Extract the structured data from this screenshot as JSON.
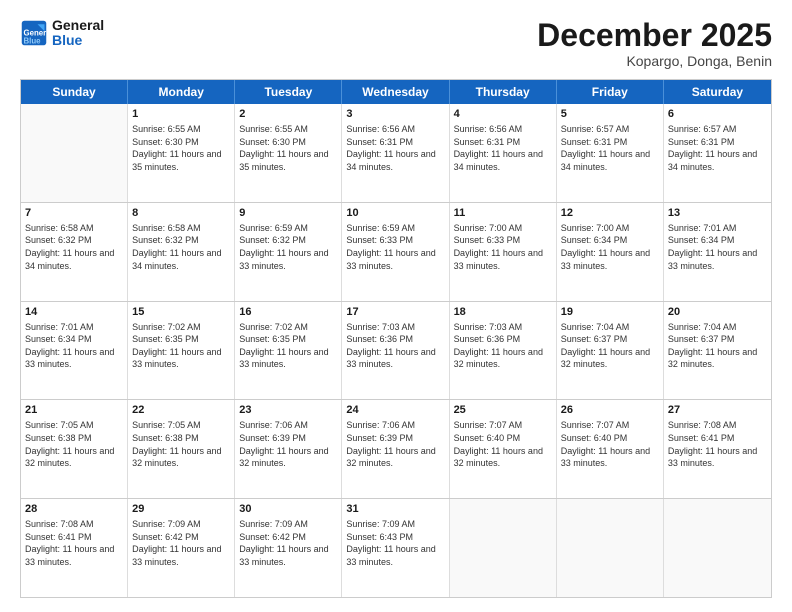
{
  "header": {
    "logo_line1": "General",
    "logo_line2": "Blue",
    "month": "December 2025",
    "location": "Kopargo, Donga, Benin"
  },
  "days_of_week": [
    "Sunday",
    "Monday",
    "Tuesday",
    "Wednesday",
    "Thursday",
    "Friday",
    "Saturday"
  ],
  "weeks": [
    [
      {
        "day": "",
        "sunrise": "",
        "sunset": "",
        "daylight": ""
      },
      {
        "day": "1",
        "sunrise": "Sunrise: 6:55 AM",
        "sunset": "Sunset: 6:30 PM",
        "daylight": "Daylight: 11 hours and 35 minutes."
      },
      {
        "day": "2",
        "sunrise": "Sunrise: 6:55 AM",
        "sunset": "Sunset: 6:30 PM",
        "daylight": "Daylight: 11 hours and 35 minutes."
      },
      {
        "day": "3",
        "sunrise": "Sunrise: 6:56 AM",
        "sunset": "Sunset: 6:31 PM",
        "daylight": "Daylight: 11 hours and 34 minutes."
      },
      {
        "day": "4",
        "sunrise": "Sunrise: 6:56 AM",
        "sunset": "Sunset: 6:31 PM",
        "daylight": "Daylight: 11 hours and 34 minutes."
      },
      {
        "day": "5",
        "sunrise": "Sunrise: 6:57 AM",
        "sunset": "Sunset: 6:31 PM",
        "daylight": "Daylight: 11 hours and 34 minutes."
      },
      {
        "day": "6",
        "sunrise": "Sunrise: 6:57 AM",
        "sunset": "Sunset: 6:31 PM",
        "daylight": "Daylight: 11 hours and 34 minutes."
      }
    ],
    [
      {
        "day": "7",
        "sunrise": "Sunrise: 6:58 AM",
        "sunset": "Sunset: 6:32 PM",
        "daylight": "Daylight: 11 hours and 34 minutes."
      },
      {
        "day": "8",
        "sunrise": "Sunrise: 6:58 AM",
        "sunset": "Sunset: 6:32 PM",
        "daylight": "Daylight: 11 hours and 34 minutes."
      },
      {
        "day": "9",
        "sunrise": "Sunrise: 6:59 AM",
        "sunset": "Sunset: 6:32 PM",
        "daylight": "Daylight: 11 hours and 33 minutes."
      },
      {
        "day": "10",
        "sunrise": "Sunrise: 6:59 AM",
        "sunset": "Sunset: 6:33 PM",
        "daylight": "Daylight: 11 hours and 33 minutes."
      },
      {
        "day": "11",
        "sunrise": "Sunrise: 7:00 AM",
        "sunset": "Sunset: 6:33 PM",
        "daylight": "Daylight: 11 hours and 33 minutes."
      },
      {
        "day": "12",
        "sunrise": "Sunrise: 7:00 AM",
        "sunset": "Sunset: 6:34 PM",
        "daylight": "Daylight: 11 hours and 33 minutes."
      },
      {
        "day": "13",
        "sunrise": "Sunrise: 7:01 AM",
        "sunset": "Sunset: 6:34 PM",
        "daylight": "Daylight: 11 hours and 33 minutes."
      }
    ],
    [
      {
        "day": "14",
        "sunrise": "Sunrise: 7:01 AM",
        "sunset": "Sunset: 6:34 PM",
        "daylight": "Daylight: 11 hours and 33 minutes."
      },
      {
        "day": "15",
        "sunrise": "Sunrise: 7:02 AM",
        "sunset": "Sunset: 6:35 PM",
        "daylight": "Daylight: 11 hours and 33 minutes."
      },
      {
        "day": "16",
        "sunrise": "Sunrise: 7:02 AM",
        "sunset": "Sunset: 6:35 PM",
        "daylight": "Daylight: 11 hours and 33 minutes."
      },
      {
        "day": "17",
        "sunrise": "Sunrise: 7:03 AM",
        "sunset": "Sunset: 6:36 PM",
        "daylight": "Daylight: 11 hours and 33 minutes."
      },
      {
        "day": "18",
        "sunrise": "Sunrise: 7:03 AM",
        "sunset": "Sunset: 6:36 PM",
        "daylight": "Daylight: 11 hours and 32 minutes."
      },
      {
        "day": "19",
        "sunrise": "Sunrise: 7:04 AM",
        "sunset": "Sunset: 6:37 PM",
        "daylight": "Daylight: 11 hours and 32 minutes."
      },
      {
        "day": "20",
        "sunrise": "Sunrise: 7:04 AM",
        "sunset": "Sunset: 6:37 PM",
        "daylight": "Daylight: 11 hours and 32 minutes."
      }
    ],
    [
      {
        "day": "21",
        "sunrise": "Sunrise: 7:05 AM",
        "sunset": "Sunset: 6:38 PM",
        "daylight": "Daylight: 11 hours and 32 minutes."
      },
      {
        "day": "22",
        "sunrise": "Sunrise: 7:05 AM",
        "sunset": "Sunset: 6:38 PM",
        "daylight": "Daylight: 11 hours and 32 minutes."
      },
      {
        "day": "23",
        "sunrise": "Sunrise: 7:06 AM",
        "sunset": "Sunset: 6:39 PM",
        "daylight": "Daylight: 11 hours and 32 minutes."
      },
      {
        "day": "24",
        "sunrise": "Sunrise: 7:06 AM",
        "sunset": "Sunset: 6:39 PM",
        "daylight": "Daylight: 11 hours and 32 minutes."
      },
      {
        "day": "25",
        "sunrise": "Sunrise: 7:07 AM",
        "sunset": "Sunset: 6:40 PM",
        "daylight": "Daylight: 11 hours and 32 minutes."
      },
      {
        "day": "26",
        "sunrise": "Sunrise: 7:07 AM",
        "sunset": "Sunset: 6:40 PM",
        "daylight": "Daylight: 11 hours and 33 minutes."
      },
      {
        "day": "27",
        "sunrise": "Sunrise: 7:08 AM",
        "sunset": "Sunset: 6:41 PM",
        "daylight": "Daylight: 11 hours and 33 minutes."
      }
    ],
    [
      {
        "day": "28",
        "sunrise": "Sunrise: 7:08 AM",
        "sunset": "Sunset: 6:41 PM",
        "daylight": "Daylight: 11 hours and 33 minutes."
      },
      {
        "day": "29",
        "sunrise": "Sunrise: 7:09 AM",
        "sunset": "Sunset: 6:42 PM",
        "daylight": "Daylight: 11 hours and 33 minutes."
      },
      {
        "day": "30",
        "sunrise": "Sunrise: 7:09 AM",
        "sunset": "Sunset: 6:42 PM",
        "daylight": "Daylight: 11 hours and 33 minutes."
      },
      {
        "day": "31",
        "sunrise": "Sunrise: 7:09 AM",
        "sunset": "Sunset: 6:43 PM",
        "daylight": "Daylight: 11 hours and 33 minutes."
      },
      {
        "day": "",
        "sunrise": "",
        "sunset": "",
        "daylight": ""
      },
      {
        "day": "",
        "sunrise": "",
        "sunset": "",
        "daylight": ""
      },
      {
        "day": "",
        "sunrise": "",
        "sunset": "",
        "daylight": ""
      }
    ]
  ]
}
